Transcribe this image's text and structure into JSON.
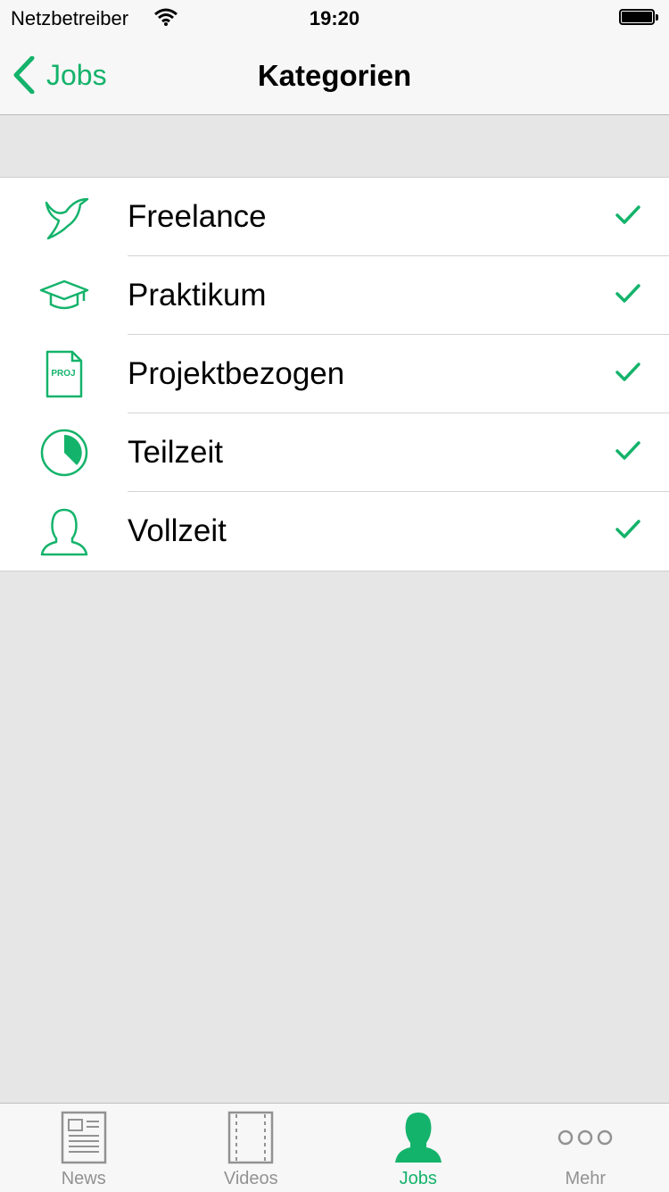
{
  "status_bar": {
    "carrier": "Netzbetreiber",
    "time": "19:20"
  },
  "nav": {
    "back_label": "Jobs",
    "title": "Kategorien"
  },
  "categories": [
    {
      "label": "Freelance",
      "icon": "bird-icon",
      "checked": true
    },
    {
      "label": "Praktikum",
      "icon": "graduation-cap-icon",
      "checked": true
    },
    {
      "label": "Projektbezogen",
      "icon": "project-document-icon",
      "icon_text": "PROJ",
      "checked": true
    },
    {
      "label": "Teilzeit",
      "icon": "pie-clock-icon",
      "checked": true
    },
    {
      "label": "Vollzeit",
      "icon": "person-outline-icon",
      "checked": true
    }
  ],
  "tabs": [
    {
      "label": "News",
      "icon": "newspaper-icon",
      "active": false
    },
    {
      "label": "Videos",
      "icon": "film-strip-icon",
      "active": false
    },
    {
      "label": "Jobs",
      "icon": "person-silhouette-icon",
      "active": true
    },
    {
      "label": "Mehr",
      "icon": "more-dots-icon",
      "active": false
    }
  ],
  "colors": {
    "accent": "#14b36b",
    "inactive": "#929292",
    "background": "#e6e6e6"
  }
}
